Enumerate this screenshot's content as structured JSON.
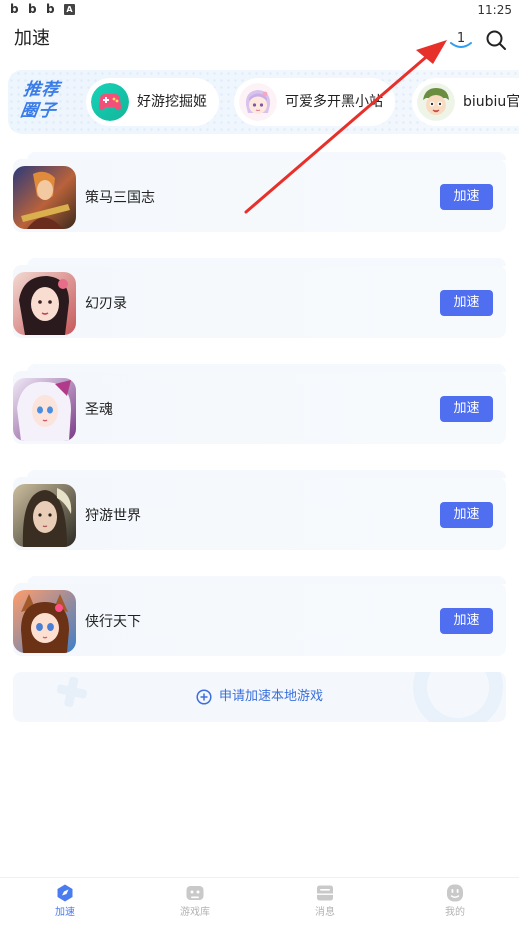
{
  "status_bar": {
    "time": "11:25",
    "left_icons": [
      "b",
      "b",
      "b",
      "A"
    ]
  },
  "header": {
    "title": "加速",
    "download_badge": "1",
    "icons": [
      "download-icon",
      "search-icon"
    ]
  },
  "promo": {
    "title": "推荐圈子",
    "circles": [
      {
        "name": "好游挖掘姬"
      },
      {
        "name": "可爱多开黑小站"
      },
      {
        "name": "biubiu官方"
      }
    ]
  },
  "games": [
    {
      "name": "策马三国志",
      "button": "加速"
    },
    {
      "name": "幻刃录",
      "button": "加速"
    },
    {
      "name": "圣魂",
      "button": "加速"
    },
    {
      "name": "狩游世界",
      "button": "加速"
    },
    {
      "name": "侠行天下",
      "button": "加速"
    }
  ],
  "apply_local": {
    "label": "申请加速本地游戏"
  },
  "bottom_nav": [
    {
      "label": "加速",
      "active": true
    },
    {
      "label": "游戏库",
      "active": false
    },
    {
      "label": "消息",
      "active": false
    },
    {
      "label": "我的",
      "active": false
    }
  ],
  "colors": {
    "accent": "#4f6ef0",
    "link": "#3a6fdc",
    "annotation": "#e8302a"
  }
}
